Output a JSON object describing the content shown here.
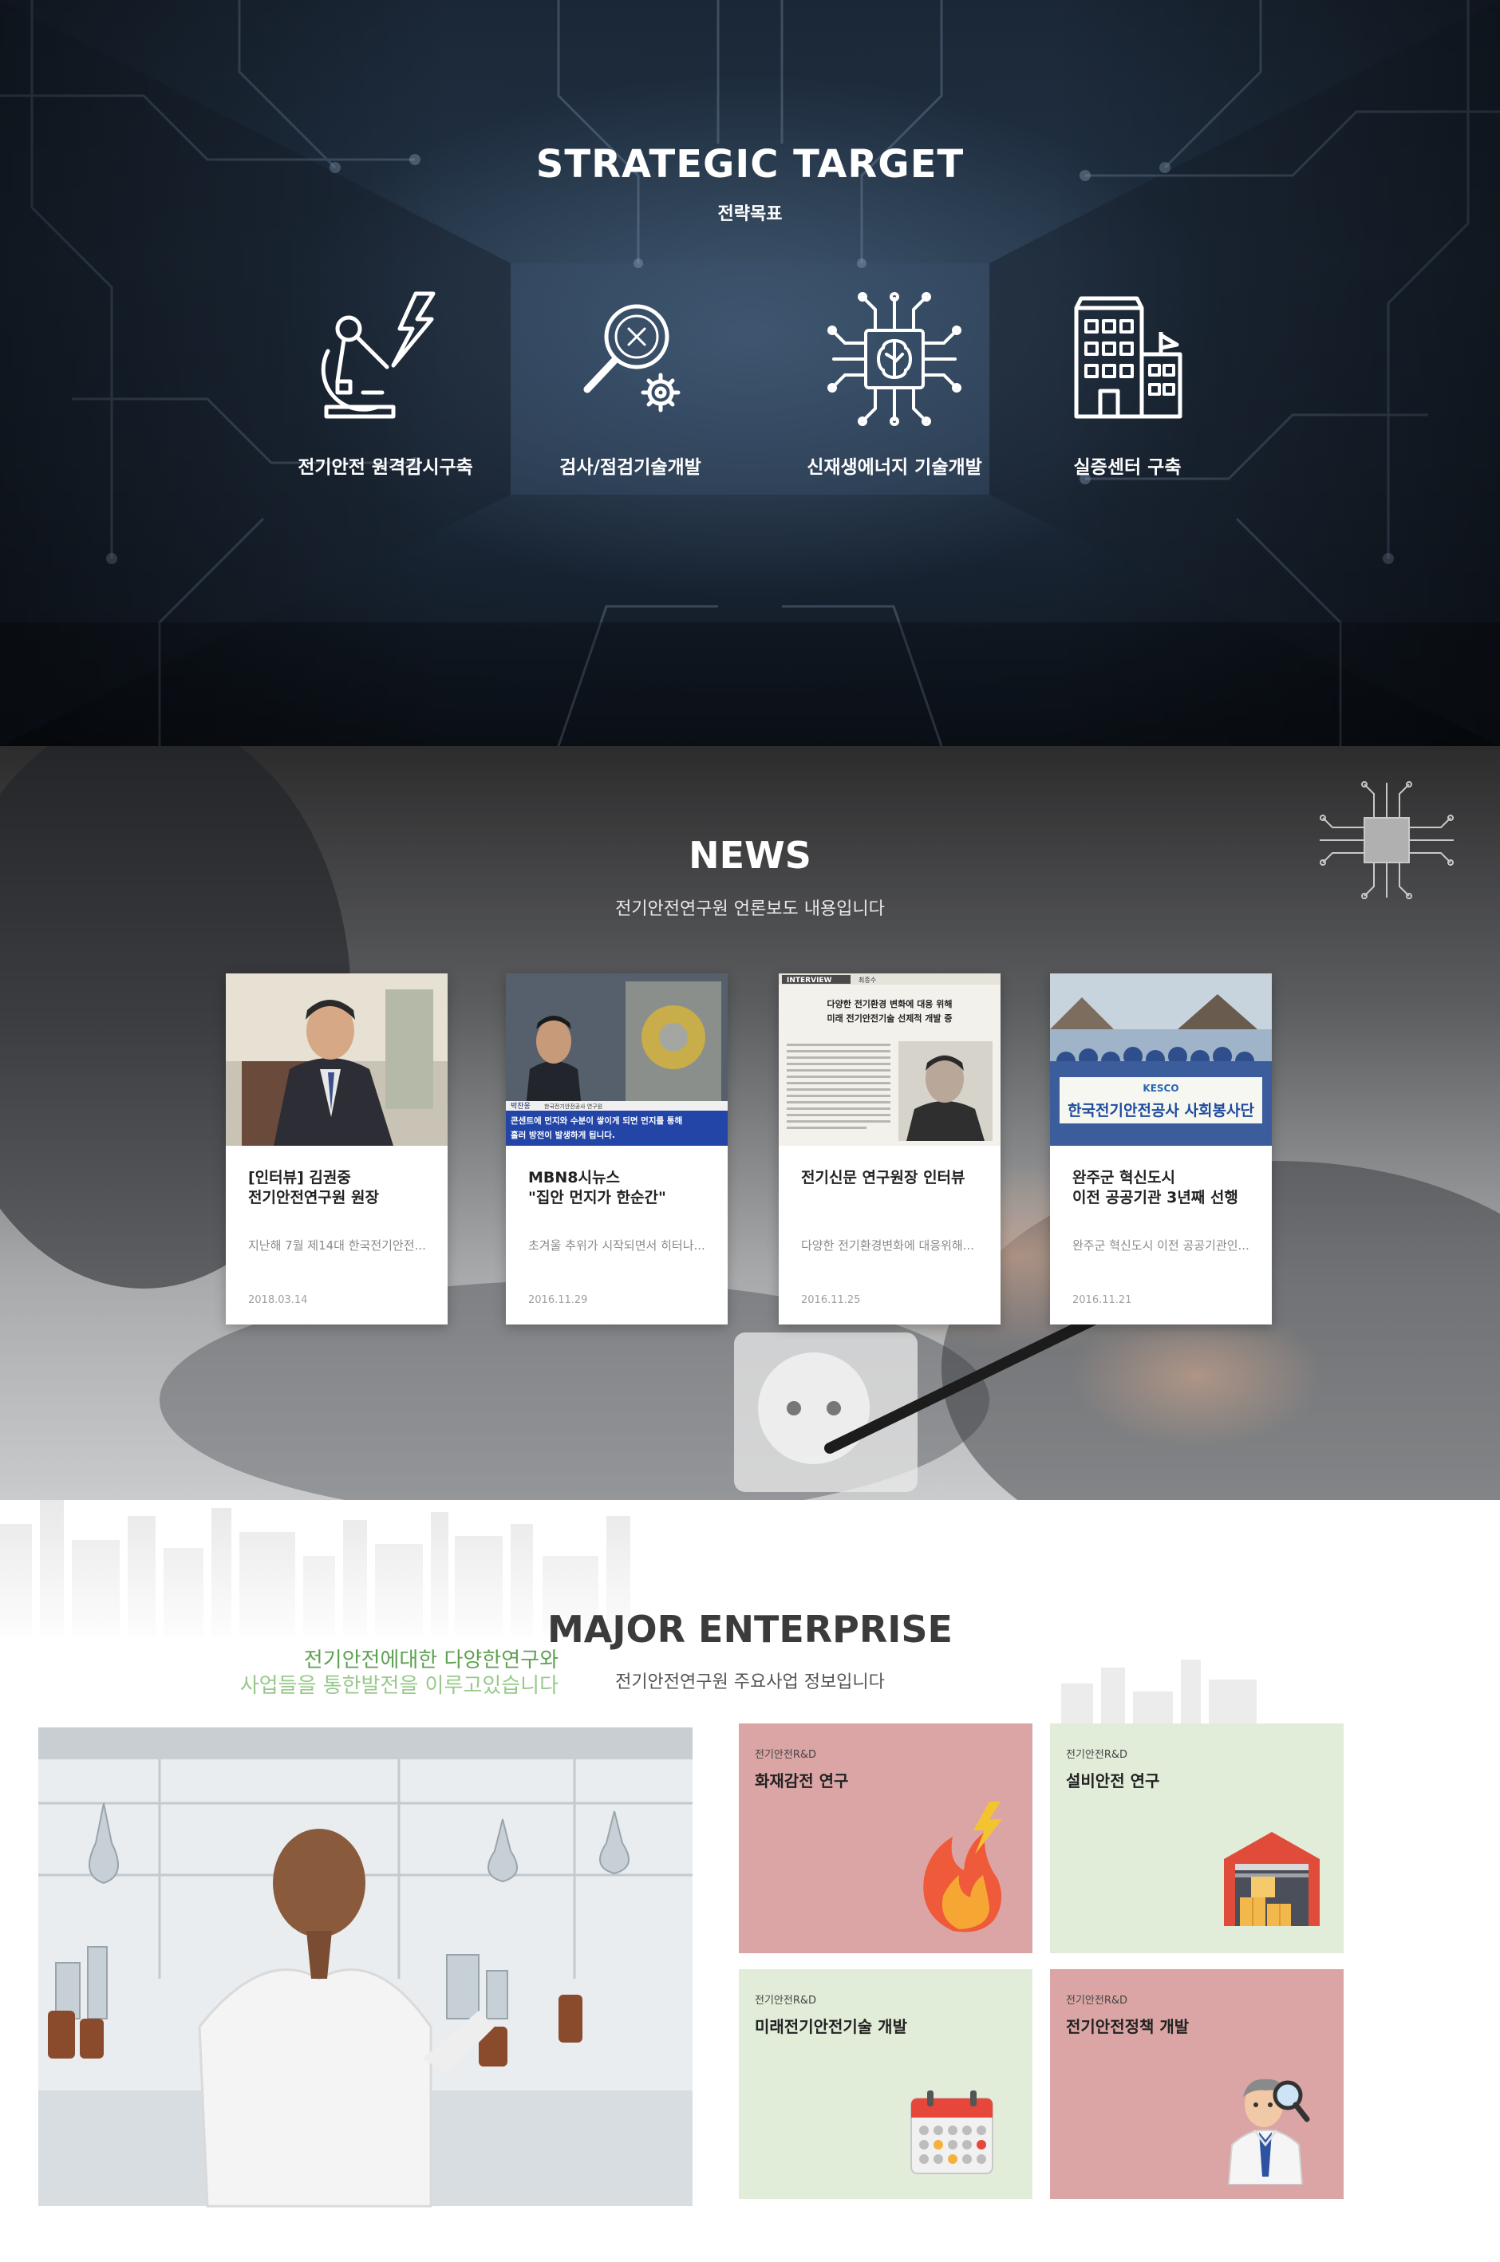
{
  "strategic": {
    "title": "STRATEGIC TARGET",
    "subtitle": "전략목표",
    "items": [
      {
        "label": "전기안전 원격감시구축",
        "icon": "microscope-lightning-icon"
      },
      {
        "label": "검사/점검기술개발",
        "icon": "magnifier-gear-icon"
      },
      {
        "label": "신재생에너지 기술개발",
        "icon": "brain-chip-icon"
      },
      {
        "label": "실증센터 구축",
        "icon": "building-icon"
      }
    ]
  },
  "news": {
    "title": "NEWS",
    "subtitle": "전기안전연구원 언론보도 내용입니다",
    "items": [
      {
        "title": "[인터뷰] 김권중\n전기안전연구원 원장",
        "excerpt": "지난해 7월 제14대 한국전기안전...",
        "date": "2018.03.14"
      },
      {
        "title": "MBN8시뉴스\n\"집안 먼지가 한순간\"",
        "excerpt": "초겨울 추위가 시작되면서 히터나...",
        "date": "2016.11.29",
        "thumb_caption_name": "박찬웅",
        "thumb_caption_org": "한국전기안전공사 연구원",
        "thumb_caption_line1": "콘센트에 먼지와 수분이 쌓이게 되면 먼지를 통해",
        "thumb_caption_line2": "흘러 방전이 발생하게 됩니다."
      },
      {
        "title": "전기신문 연구원장 인터뷰",
        "excerpt": "다양한 전기환경변화에 대응위해...",
        "date": "2016.11.25",
        "thumb_tag": "INTERVIEW",
        "thumb_name": "최종수",
        "thumb_headline1": "다양한 전기환경 변화에 대응 위해",
        "thumb_headline2": "미래 전기안전기술 선제적 개발 중"
      },
      {
        "title": "완주군 혁신도시\n이전 공공기관 3년째 선행",
        "excerpt": "완주군 혁신도시 이전 공공기관인...",
        "date": "2016.11.21",
        "thumb_logo": "KESCO",
        "thumb_banner": "한국전기안전공사 사회봉사단"
      }
    ]
  },
  "enterprise": {
    "title": "MAJOR ENTERPRISE",
    "subtitle": "전기안전연구원 주요사업 정보입니다",
    "slogan_line1": "전기안전에대한 다양한연구와",
    "slogan_line2": "사업들을 통한발전을 이루고있습니다",
    "cards": [
      {
        "category": "전기안전R&D",
        "title": "화재감전 연구",
        "bg": "#dba5a5",
        "icon": "fire-lightning-icon"
      },
      {
        "category": "전기안전R&D",
        "title": "설비안전 연구",
        "bg": "#e1ecd9",
        "icon": "warehouse-icon"
      },
      {
        "category": "전기안전R&D",
        "title": "미래전기안전기술 개발",
        "bg": "#e1ecd9",
        "icon": "calendar-icon"
      },
      {
        "category": "전기안전R&D",
        "title": "전기안전정책 개발",
        "bg": "#dba5a5",
        "icon": "inspector-icon"
      }
    ]
  }
}
